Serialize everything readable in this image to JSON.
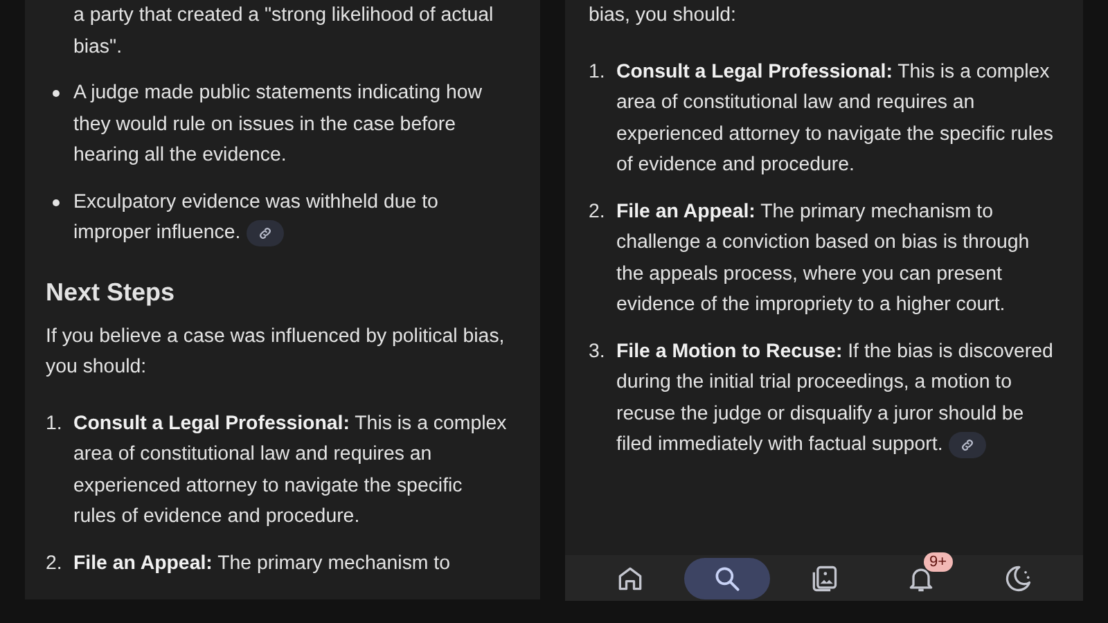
{
  "left_panel": {
    "bullets": [
      {
        "text": "a party that created a \"strong likelihood of actual bias\".",
        "continued": true,
        "link": false
      },
      {
        "text": "A judge made public statements indicating how they would rule on issues in the case before hearing all the evidence.",
        "continued": false,
        "link": false
      },
      {
        "text": "Exculpatory evidence was withheld due to improper influence.",
        "continued": false,
        "link": true
      }
    ],
    "heading": "Next Steps",
    "intro": "If you believe a case was influenced by political bias, you should:",
    "steps": [
      {
        "number": "1.",
        "title": "Consult a Legal Professional:",
        "text": "This is a complex area of constitutional law and requires an experienced attorney to navigate the specific rules of evidence and procedure.",
        "link": false
      },
      {
        "number": "2.",
        "title": "File an Appeal:",
        "text": "The primary mechanism to",
        "link": false
      }
    ]
  },
  "right_panel": {
    "intro": "bias, you should:",
    "steps": [
      {
        "number": "1.",
        "title": "Consult a Legal Professional:",
        "text": "This is a complex area of constitutional law and requires an experienced attorney to navigate the specific rules of evidence and procedure.",
        "link": false
      },
      {
        "number": "2.",
        "title": "File an Appeal:",
        "text": "The primary mechanism to challenge a conviction based on bias is through the appeals process, where you can present evidence of the impropriety to a higher court.",
        "link": false
      },
      {
        "number": "3.",
        "title": "File a Motion to Recuse:",
        "text": "If the bias is discovered during the initial trial proceedings, a motion to recuse the judge or disqualify a juror should be filed immediately with factual support.",
        "link": true
      }
    ]
  },
  "nav_bar": [
    {
      "kind": "home",
      "selected": false
    },
    {
      "kind": "search",
      "selected": true
    },
    {
      "kind": "gallery",
      "selected": false
    },
    {
      "kind": "notifications",
      "selected": false,
      "badge": "9+"
    },
    {
      "kind": "sleep",
      "selected": false
    }
  ]
}
